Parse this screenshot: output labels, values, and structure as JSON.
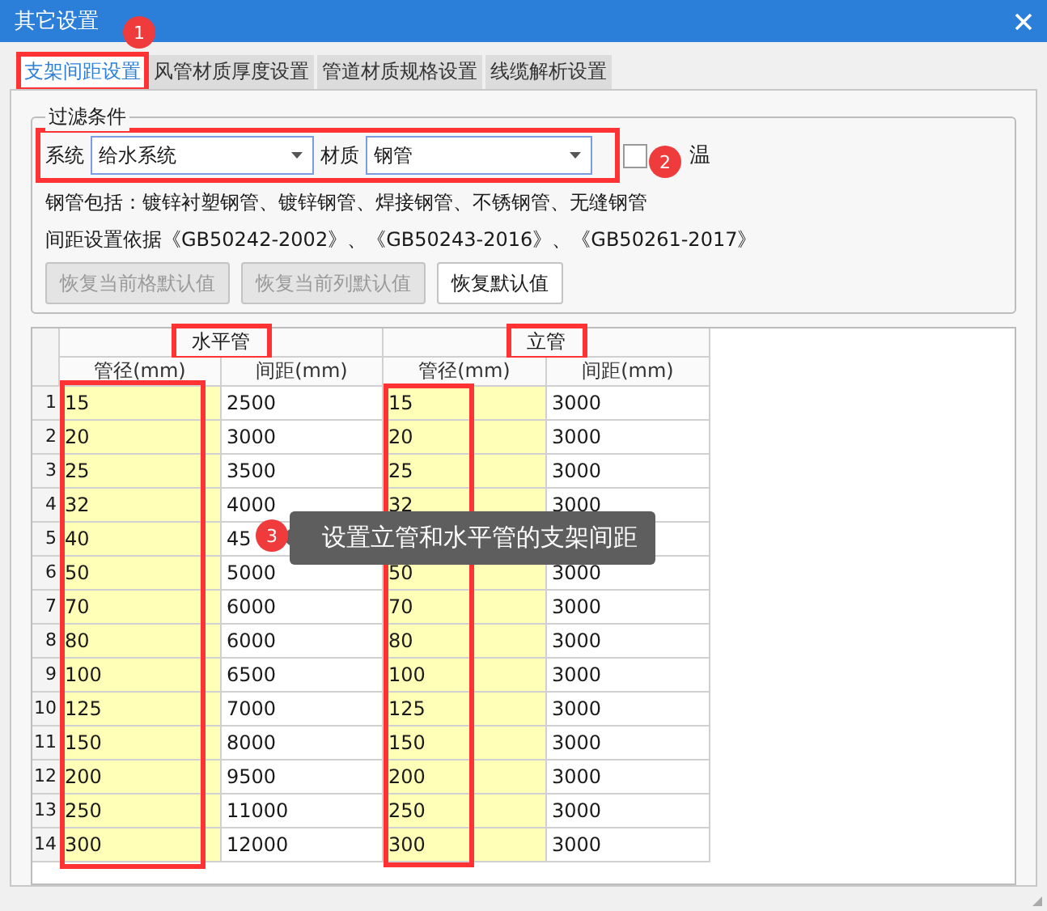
{
  "window": {
    "title": "其它设置"
  },
  "tabs": [
    {
      "label": "支架间距设置",
      "selected": true
    },
    {
      "label": "风管材质厚度设置",
      "selected": false
    },
    {
      "label": "管道材质规格设置",
      "selected": false
    },
    {
      "label": "线缆解析设置",
      "selected": false
    }
  ],
  "filter": {
    "title": "过滤条件",
    "system_label": "系统",
    "system_value": "给水系统",
    "material_label": "材质",
    "material_value": "钢管",
    "insulation": {
      "label": "温",
      "checked": false
    },
    "note_1": "钢管包括：镀锌衬塑钢管、镀锌钢管、焊接钢管、不锈钢管、无缝钢管",
    "note_2": "间距设置依据《GB50242-2002》、《GB50243-2016》、《GB50261-2017》",
    "buttons": [
      {
        "label": "恢复当前格默认值",
        "disabled": true
      },
      {
        "label": "恢复当前列默认值",
        "disabled": true
      },
      {
        "label": "恢复默认值",
        "disabled": false
      }
    ]
  },
  "table": {
    "groups": [
      "水平管",
      "立管"
    ],
    "columns": [
      {
        "label": "管径(mm)",
        "highlighted": true
      },
      {
        "label": "间距(mm)",
        "highlighted": false
      },
      {
        "label": "管径(mm)",
        "highlighted": true
      },
      {
        "label": "间距(mm)",
        "highlighted": false
      }
    ],
    "rows": [
      {
        "number": "1",
        "cells": [
          "15",
          "2500",
          "15",
          "3000"
        ]
      },
      {
        "number": "2",
        "cells": [
          "20",
          "3000",
          "20",
          "3000"
        ]
      },
      {
        "number": "3",
        "cells": [
          "25",
          "3500",
          "25",
          "3000"
        ]
      },
      {
        "number": "4",
        "cells": [
          "32",
          "4000",
          "32",
          "3000"
        ]
      },
      {
        "number": "5",
        "cells": [
          "40",
          "45",
          null,
          null
        ]
      },
      {
        "number": "6",
        "cells": [
          "50",
          "5000",
          "50",
          "3000"
        ]
      },
      {
        "number": "7",
        "cells": [
          "70",
          "6000",
          "70",
          "3000"
        ]
      },
      {
        "number": "8",
        "cells": [
          "80",
          "6000",
          "80",
          "3000"
        ]
      },
      {
        "number": "9",
        "cells": [
          "100",
          "6500",
          "100",
          "3000"
        ]
      },
      {
        "number": "10",
        "cells": [
          "125",
          "7000",
          "125",
          "3000"
        ]
      },
      {
        "number": "11",
        "cells": [
          "150",
          "8000",
          "150",
          "3000"
        ]
      },
      {
        "number": "12",
        "cells": [
          "200",
          "9500",
          "200",
          "3000"
        ]
      },
      {
        "number": "13",
        "cells": [
          "250",
          "11000",
          "250",
          "3000"
        ]
      },
      {
        "number": "14",
        "cells": [
          "300",
          "12000",
          "300",
          "3000"
        ]
      }
    ]
  },
  "callouts": [
    "1",
    "2",
    "3"
  ],
  "tooltip": "设置立管和水平管的支架间距"
}
